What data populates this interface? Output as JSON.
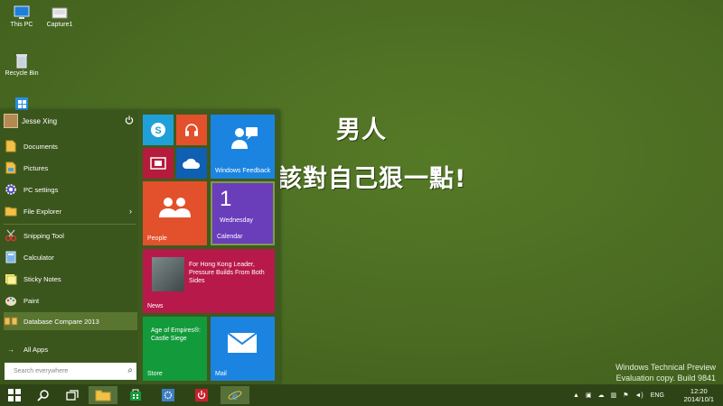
{
  "desktop": {
    "icons": [
      {
        "label": "This PC",
        "icon": "computer-icon"
      },
      {
        "label": "Capture1",
        "icon": "image-file-icon"
      },
      {
        "label": "Recycle Bin",
        "icon": "recycle-bin-icon"
      },
      {
        "label": "",
        "icon": "windows-shortcut-icon"
      }
    ],
    "watermark_line1": "男人",
    "watermark_line2": "該對自己狠一點!",
    "tech_preview_line1": "Windows Technical Preview",
    "tech_preview_line2": "Evaluation copy. Build 9841"
  },
  "start_menu": {
    "user_name": "Jesse Xing",
    "items": [
      {
        "label": "Documents",
        "icon": "documents-icon"
      },
      {
        "label": "Pictures",
        "icon": "pictures-icon"
      },
      {
        "label": "PC settings",
        "icon": "gear-icon"
      },
      {
        "label": "File Explorer",
        "icon": "folder-icon"
      },
      {
        "label": "Snipping Tool",
        "icon": "scissors-icon"
      },
      {
        "label": "Calculator",
        "icon": "calculator-icon"
      },
      {
        "label": "Sticky Notes",
        "icon": "sticky-notes-icon"
      },
      {
        "label": "Paint",
        "icon": "paint-icon"
      },
      {
        "label": "Database Compare 2013",
        "icon": "database-compare-icon"
      }
    ],
    "all_apps": "All Apps",
    "search_placeholder": "Search everywhere",
    "tiles": {
      "skype": {
        "icon": "skype-icon",
        "color": "#1fa0d8"
      },
      "music": {
        "icon": "headphones-icon",
        "color": "#e2512b"
      },
      "video": {
        "icon": "video-icon",
        "color": "#b51b3a"
      },
      "onedrive": {
        "icon": "cloud-icon",
        "color": "#0f5fb2"
      },
      "feedback": {
        "label": "Windows Feedback",
        "icon": "feedback-icon",
        "color": "#1b84e0"
      },
      "people": {
        "label": "People",
        "icon": "people-icon",
        "color": "#e2512b"
      },
      "calendar": {
        "label": "Calendar",
        "day_number": "1",
        "day_name": "Wednesday",
        "color": "#6a3dbb"
      },
      "news": {
        "label": "News",
        "headline": "For Hong Kong Leader, Pressure Builds From Both Sides",
        "color": "#b8194b"
      },
      "store": {
        "label": "Store",
        "app_title": "Age of Empires®: Castle Siege",
        "color": "#139a3b"
      },
      "mail": {
        "label": "Mail",
        "icon": "mail-icon",
        "color": "#1b84e0"
      }
    }
  },
  "taskbar": {
    "language": "ENG",
    "time": "12:20",
    "date": "2014/10/1"
  }
}
